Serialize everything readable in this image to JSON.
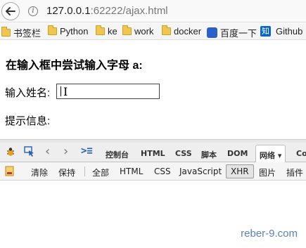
{
  "browser": {
    "url_host": "127.0.0.1",
    "url_port": ":62222",
    "url_path": "/ajax.html"
  },
  "bookmarks": [
    {
      "label": "书签栏",
      "icon": "folder-icon"
    },
    {
      "label": "Python",
      "icon": "folder-icon"
    },
    {
      "label": "ke",
      "icon": "folder-icon"
    },
    {
      "label": "work",
      "icon": "folder-icon"
    },
    {
      "label": "docker",
      "icon": "folder-icon"
    },
    {
      "label": "百度一下",
      "icon": "baidu-paw-icon"
    },
    {
      "label": "知",
      "icon": "zhihu-icon"
    },
    {
      "label": "Github",
      "icon": "github-icon"
    }
  ],
  "page": {
    "title": "在输入框中尝试输入字母 a:",
    "name_label": "输入姓名:",
    "name_value": "",
    "hint_label": "提示信息:"
  },
  "firebug": {
    "nav_back": "‹",
    "nav_forward": "›",
    "cmd_symbol": ">≡",
    "tabs": [
      "控制台",
      "HTML",
      "CSS",
      "脚本",
      "DOM",
      "网络 ▾",
      "Co"
    ],
    "active_tab_index": 5,
    "filters": [
      "清除",
      "保持",
      "全部",
      "HTML",
      "CSS",
      "JavaScript",
      "XHR",
      "图片",
      "插件"
    ],
    "selected_filter": "XHR"
  },
  "watermark": "reber-9.com",
  "colors": {
    "accent_link": "#5a82c0",
    "folder": "#f0c550"
  }
}
